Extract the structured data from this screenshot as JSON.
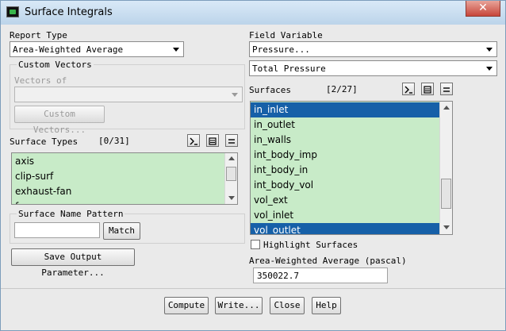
{
  "window": {
    "title": "Surface Integrals",
    "close_glyph": "✕"
  },
  "report_type": {
    "label": "Report Type",
    "value": "Area-Weighted Average"
  },
  "custom_vectors": {
    "label": "Custom Vectors",
    "vectors_of_label": "Vectors of",
    "vectors_of_value": "",
    "button": "Custom Vectors..."
  },
  "surface_types": {
    "label": "Surface Types",
    "count": "[0/31]",
    "items": [
      "axis",
      "clip-surf",
      "exhaust-fan",
      "f"
    ]
  },
  "name_pattern": {
    "label": "Surface Name Pattern",
    "value": "",
    "match_button": "Match"
  },
  "save_button": "Save Output Parameter...",
  "field_variable": {
    "label": "Field Variable",
    "category": "Pressure...",
    "variable": "Total Pressure"
  },
  "surfaces": {
    "label": "Surfaces",
    "count": "[2/27]",
    "items": [
      {
        "name": "in_inlet",
        "selected": true
      },
      {
        "name": "in_outlet",
        "selected": false
      },
      {
        "name": "in_walls",
        "selected": false
      },
      {
        "name": "int_body_imp",
        "selected": false
      },
      {
        "name": "int_body_in",
        "selected": false
      },
      {
        "name": "int_body_vol",
        "selected": false
      },
      {
        "name": "vol_ext",
        "selected": false
      },
      {
        "name": "vol_inlet",
        "selected": false
      },
      {
        "name": "vol_outlet",
        "selected": true
      }
    ]
  },
  "highlight": {
    "label": "Highlight Surfaces",
    "checked": false
  },
  "result": {
    "label": "Area-Weighted Average (pascal)",
    "value": "350022.7"
  },
  "buttons": {
    "compute": "Compute",
    "write": "Write...",
    "close": "Close",
    "help": "Help"
  },
  "colors": {
    "list_bg": "#c8ebc8",
    "selection": "#1660a8",
    "title_bar": "#bcd4ea"
  },
  "icons": [
    "window-app-icon",
    "close-icon",
    "select-all-icon",
    "deselect-all-icon",
    "list-options-icon",
    "dropdown-arrow-icon",
    "scroll-up-icon",
    "scroll-down-icon"
  ]
}
